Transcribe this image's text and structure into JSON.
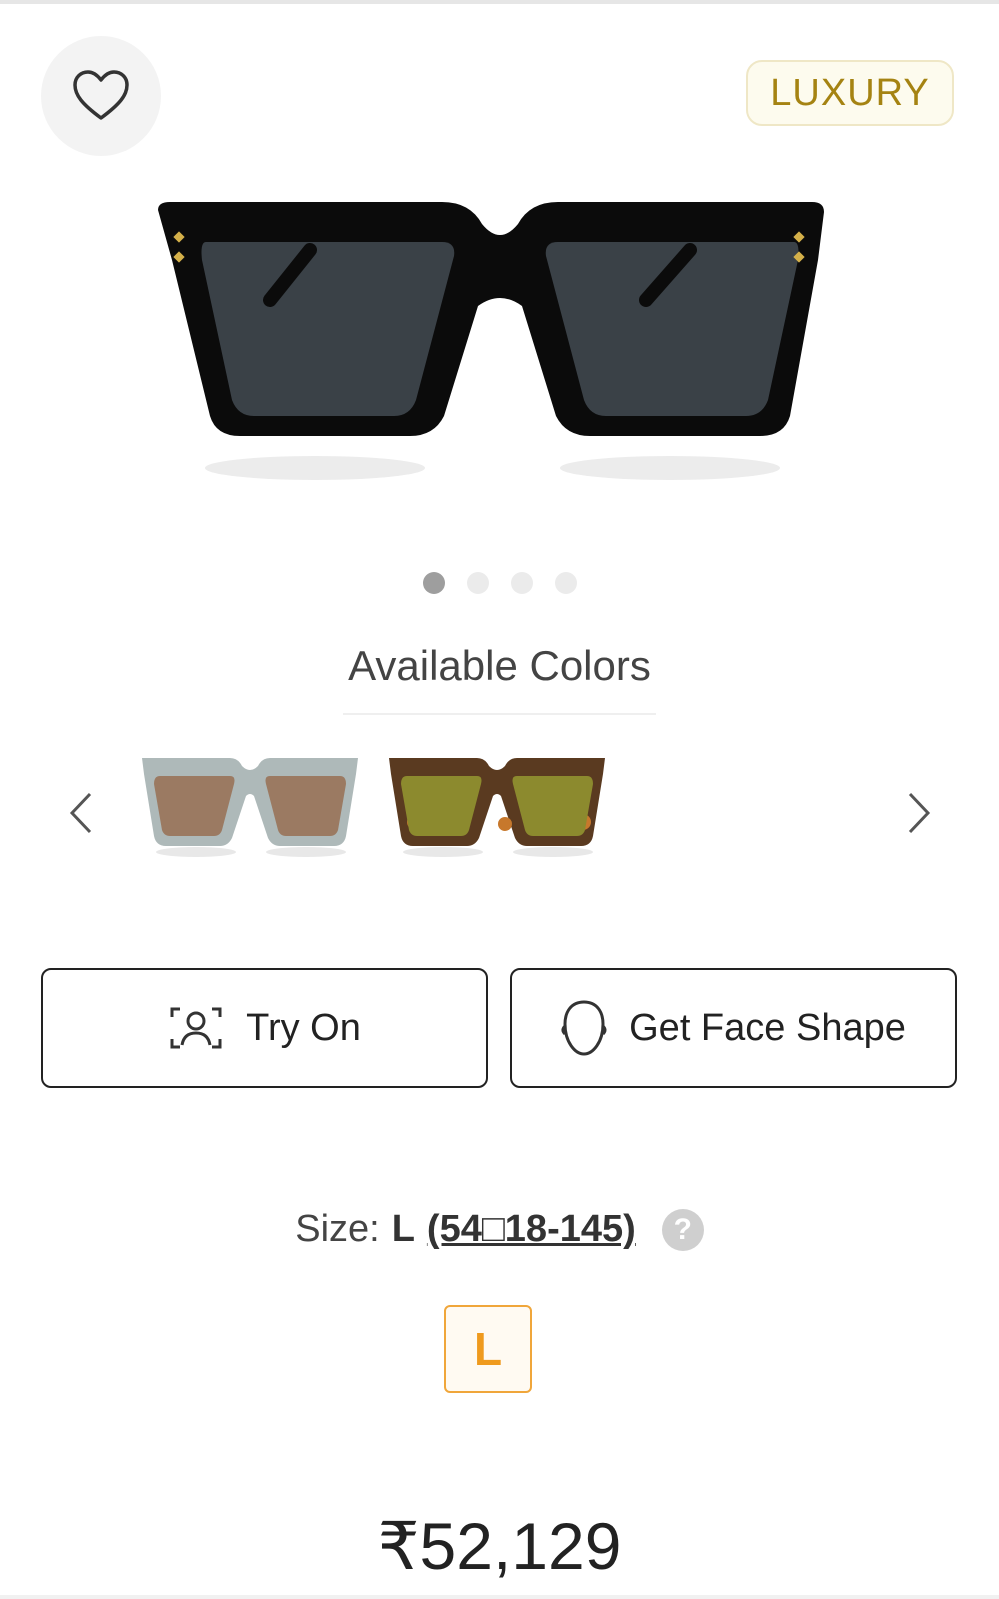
{
  "badge": {
    "label": "LUXURY"
  },
  "gallery": {
    "slides": 4,
    "active": 1
  },
  "available_colors": {
    "title": "Available Colors",
    "swatches": [
      {
        "name": "grey-transparent-frame",
        "frame": "#aeb9b9",
        "lens": "#9b7a62"
      },
      {
        "name": "havana-frame",
        "frame": "#5a3a20",
        "lens": "#8c8a2e"
      }
    ]
  },
  "actions": {
    "try_on": "Try On",
    "face_shape": "Get Face Shape"
  },
  "size": {
    "label": "Size:",
    "value": "L",
    "dims": "(54□18-145)",
    "help": "?",
    "options": [
      "L"
    ]
  },
  "price": "₹52,129",
  "colors": {
    "badge_text": "#a58312",
    "size_accent": "#ef9a1e"
  }
}
